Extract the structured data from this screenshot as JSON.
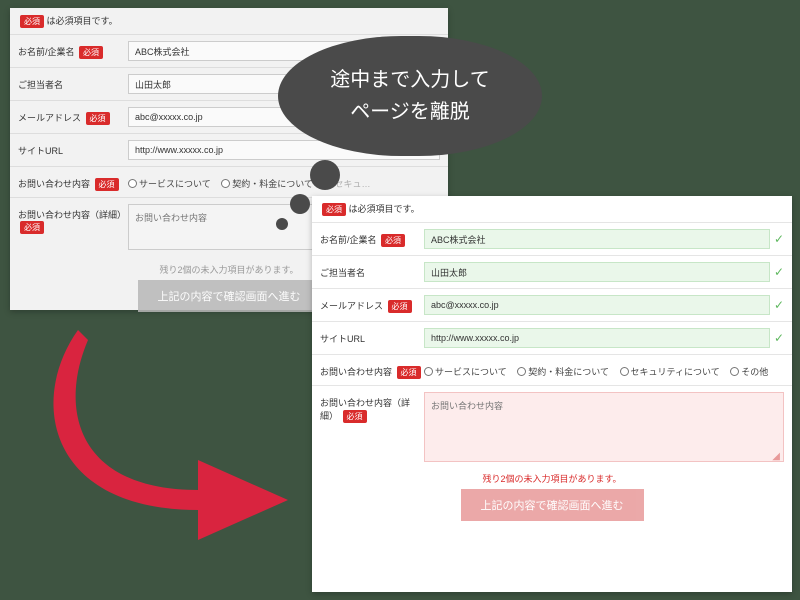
{
  "badge_text": "必須",
  "required_note_suffix": " は必須項目です。",
  "labels": {
    "name": "お名前/企業名",
    "person": "ご担当者名",
    "email": "メールアドレス",
    "url": "サイトURL",
    "inquiry_type": "お問い合わせ内容",
    "inquiry_detail": "お問い合わせ内容（詳細）"
  },
  "values": {
    "name": "ABC株式会社",
    "person": "山田太郎",
    "email": "abc@xxxxx.co.jp",
    "url": "http://www.xxxxx.co.jp"
  },
  "radio_options": [
    "サービスについて",
    "契約・料金について",
    "セキュリティについて",
    "その他"
  ],
  "textarea_placeholder": "お問い合わせ内容",
  "remaining_notice": "残り2個の未入力項目があります。",
  "submit_label": "上記の内容で確認画面へ進む",
  "bubble_line1": "途中まで入力して",
  "bubble_line2": "ページを離脱",
  "colors": {
    "accent_red": "#d92b2b",
    "ok_green": "#5fb85f",
    "submit_pink": "#e89a9a",
    "bubble_gray": "#4a4a4a",
    "arrow_red": "#d9243f"
  }
}
